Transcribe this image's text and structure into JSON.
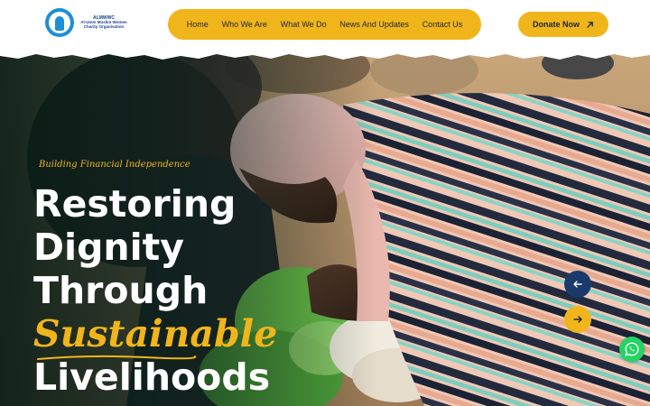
{
  "header": {
    "logo": {
      "abbr": "ALMWWC",
      "name": "Al-Umm Muslim Women Charity Organisation"
    },
    "nav": [
      {
        "label": "Home"
      },
      {
        "label": "Who We Are"
      },
      {
        "label": "What We Do"
      },
      {
        "label": "News And Updates"
      },
      {
        "label": "Contact Us"
      }
    ],
    "donate": {
      "label": "Donate Now",
      "icon": "arrow-up-right-icon"
    }
  },
  "hero": {
    "tagline": "Building Financial Independence",
    "headline": {
      "line1": "Restoring",
      "line2": "Dignity",
      "line3": "Through",
      "accent": "Sustainable",
      "line5": "Livelihoods"
    },
    "slider": {
      "prev_icon": "arrow-left-icon",
      "next_icon": "arrow-right-icon"
    },
    "whatsapp_icon": "whatsapp-icon"
  },
  "colors": {
    "accent": "#f1b51c",
    "navy": "#1a3a6b",
    "whatsapp": "#25d366",
    "text_dark": "#1b2430"
  }
}
